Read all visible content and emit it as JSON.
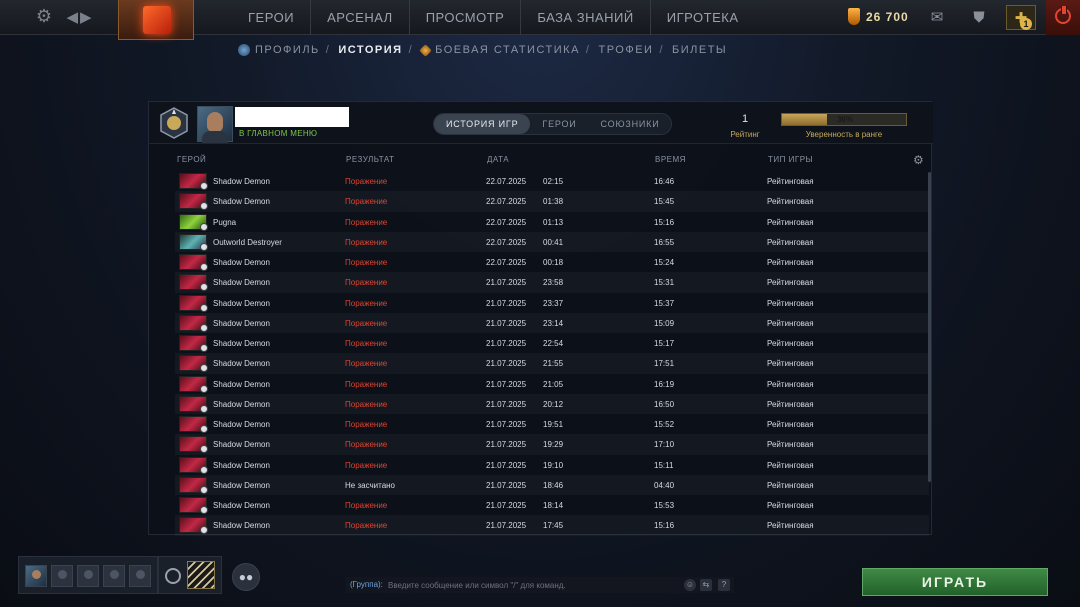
{
  "topbar": {
    "nav": [
      "ГЕРОИ",
      "АРСЕНАЛ",
      "ПРОСМОТР",
      "БАЗА ЗНАНИЙ",
      "ИГРОТЕКА"
    ],
    "currency": "26 700",
    "notification_count": "1"
  },
  "subnav": {
    "items": [
      "ПРОФИЛЬ",
      "ИСТОРИЯ",
      "БОЕВАЯ СТАТИСТИКА",
      "ТРОФЕИ",
      "БИЛЕТЫ"
    ],
    "separator": "/",
    "active": "ИСТОРИЯ"
  },
  "profile": {
    "status": "В ГЛАВНОМ МЕНЮ",
    "tabs": [
      "ИСТОРИЯ ИГР",
      "ГЕРОИ",
      "СОЮЗНИКИ"
    ],
    "active_tab": "ИСТОРИЯ ИГР",
    "rating_value": "1",
    "rating_label": "Рейтинг",
    "confidence_text": "36%",
    "confidence_fraction": 0.36,
    "confidence_label": "Уверенность в ранге"
  },
  "table": {
    "headers": {
      "hero": "ГЕРОЙ",
      "result": "РЕЗУЛЬТАТ",
      "date": "ДАТА",
      "duration": "ВРЕМЯ",
      "type": "ТИП ИГРЫ"
    },
    "rows": [
      {
        "hero": "Shadow Demon",
        "icon": "sd",
        "result": "Поражение",
        "result_kind": "loss",
        "date": "22.07.2025",
        "time": "02:15",
        "duration": "16:46",
        "type": "Рейтинговая"
      },
      {
        "hero": "Shadow Demon",
        "icon": "sd",
        "result": "Поражение",
        "result_kind": "loss",
        "date": "22.07.2025",
        "time": "01:38",
        "duration": "15:45",
        "type": "Рейтинговая"
      },
      {
        "hero": "Pugna",
        "icon": "pugna",
        "result": "Поражение",
        "result_kind": "loss",
        "date": "22.07.2025",
        "time": "01:13",
        "duration": "15:16",
        "type": "Рейтинговая"
      },
      {
        "hero": "Outworld Destroyer",
        "icon": "od",
        "result": "Поражение",
        "result_kind": "loss",
        "date": "22.07.2025",
        "time": "00:41",
        "duration": "16:55",
        "type": "Рейтинговая"
      },
      {
        "hero": "Shadow Demon",
        "icon": "sd",
        "result": "Поражение",
        "result_kind": "loss",
        "date": "22.07.2025",
        "time": "00:18",
        "duration": "15:24",
        "type": "Рейтинговая"
      },
      {
        "hero": "Shadow Demon",
        "icon": "sd",
        "result": "Поражение",
        "result_kind": "loss",
        "date": "21.07.2025",
        "time": "23:58",
        "duration": "15:31",
        "type": "Рейтинговая"
      },
      {
        "hero": "Shadow Demon",
        "icon": "sd",
        "result": "Поражение",
        "result_kind": "loss",
        "date": "21.07.2025",
        "time": "23:37",
        "duration": "15:37",
        "type": "Рейтинговая"
      },
      {
        "hero": "Shadow Demon",
        "icon": "sd",
        "result": "Поражение",
        "result_kind": "loss",
        "date": "21.07.2025",
        "time": "23:14",
        "duration": "15:09",
        "type": "Рейтинговая"
      },
      {
        "hero": "Shadow Demon",
        "icon": "sd",
        "result": "Поражение",
        "result_kind": "loss",
        "date": "21.07.2025",
        "time": "22:54",
        "duration": "15:17",
        "type": "Рейтинговая"
      },
      {
        "hero": "Shadow Demon",
        "icon": "sd",
        "result": "Поражение",
        "result_kind": "loss",
        "date": "21.07.2025",
        "time": "21:55",
        "duration": "17:51",
        "type": "Рейтинговая"
      },
      {
        "hero": "Shadow Demon",
        "icon": "sd",
        "result": "Поражение",
        "result_kind": "loss",
        "date": "21.07.2025",
        "time": "21:05",
        "duration": "16:19",
        "type": "Рейтинговая"
      },
      {
        "hero": "Shadow Demon",
        "icon": "sd",
        "result": "Поражение",
        "result_kind": "loss",
        "date": "21.07.2025",
        "time": "20:12",
        "duration": "16:50",
        "type": "Рейтинговая"
      },
      {
        "hero": "Shadow Demon",
        "icon": "sd",
        "result": "Поражение",
        "result_kind": "loss",
        "date": "21.07.2025",
        "time": "19:51",
        "duration": "15:52",
        "type": "Рейтинговая"
      },
      {
        "hero": "Shadow Demon",
        "icon": "sd",
        "result": "Поражение",
        "result_kind": "loss",
        "date": "21.07.2025",
        "time": "19:29",
        "duration": "17:10",
        "type": "Рейтинговая"
      },
      {
        "hero": "Shadow Demon",
        "icon": "sd",
        "result": "Поражение",
        "result_kind": "loss",
        "date": "21.07.2025",
        "time": "19:10",
        "duration": "15:11",
        "type": "Рейтинговая"
      },
      {
        "hero": "Shadow Demon",
        "icon": "sd",
        "result": "Не засчитано",
        "result_kind": "neutral",
        "date": "21.07.2025",
        "time": "18:46",
        "duration": "04:40",
        "type": "Рейтинговая"
      },
      {
        "hero": "Shadow Demon",
        "icon": "sd",
        "result": "Поражение",
        "result_kind": "loss",
        "date": "21.07.2025",
        "time": "18:14",
        "duration": "15:53",
        "type": "Рейтинговая"
      },
      {
        "hero": "Shadow Demon",
        "icon": "sd",
        "result": "Поражение",
        "result_kind": "loss",
        "date": "21.07.2025",
        "time": "17:45",
        "duration": "15:16",
        "type": "Рейтинговая"
      }
    ]
  },
  "chat": {
    "prefix": "(Группа):",
    "placeholder": "Введите сообщение или символ \"/\" для команд.",
    "help": "?"
  },
  "play_button": "ИГРАТЬ",
  "colors": {
    "loss": "#e0432e",
    "accent_gold": "#c8a95a",
    "play_green": "#3f8a45"
  }
}
